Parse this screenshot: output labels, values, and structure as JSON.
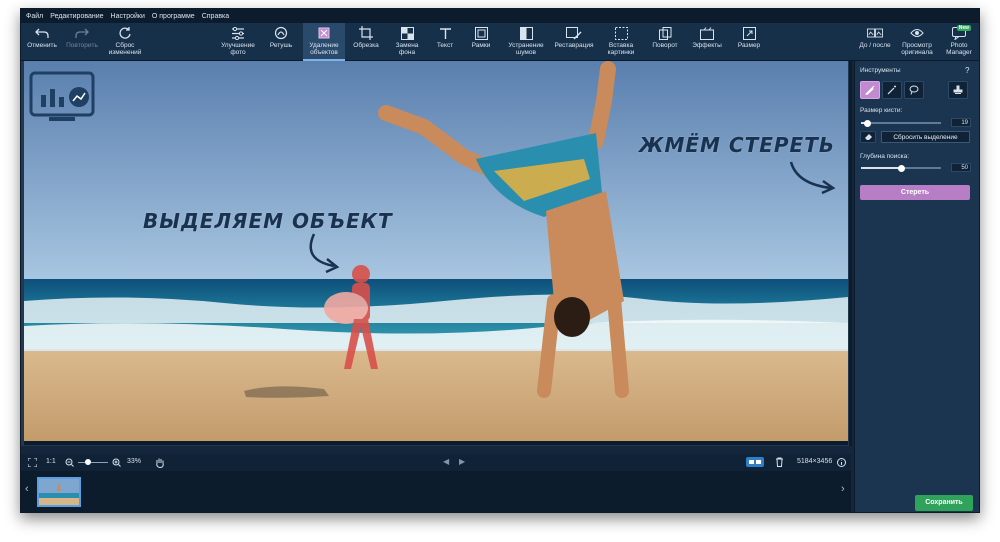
{
  "menu": [
    "Файл",
    "Редактирование",
    "Настройки",
    "О программе",
    "Справка"
  ],
  "toolbar": {
    "undo": "Отменить",
    "redo": "Повторить",
    "reset": "Сброс\nизменений",
    "enhance": "Улучшение\nфото",
    "retouch": "Ретушь",
    "remove": "Удаление\nобъектов",
    "crop": "Обрезка",
    "background": "Замена\nфона",
    "text": "Текст",
    "frames": "Рамки",
    "denoise": "Устранение\nшумов",
    "restore": "Реставрация",
    "insert": "Вставка\nкартинки",
    "rotate": "Поворот",
    "effects": "Эффекты",
    "resize": "Размер",
    "before_after": "До / после",
    "preview": "Просмотр\nоригинала",
    "photo_manager": "Photo\nManager",
    "new_badge": "New"
  },
  "annotations": {
    "select_object": "ВЫДЕЛЯЕМ ОБЪЕКТ",
    "press_erase": "ЖМЁМ СТЕРЕТЬ"
  },
  "panel": {
    "tools_title": "Инструменты",
    "help": "?",
    "brush_size_label": "Размер кисти:",
    "brush_size_value": "19",
    "brush_size_fraction": 0.08,
    "reset_selection": "Сбросить выделение",
    "search_depth_label": "Глубина поиска:",
    "search_depth_value": "50",
    "search_depth_fraction": 0.5,
    "erase": "Стереть",
    "save": "Сохранить"
  },
  "status": {
    "fit": "1:1",
    "zoom": "33%",
    "zoom_fraction": 0.33,
    "dimensions": "5184×3456"
  },
  "colors": {
    "accent": "#b77ec6",
    "save": "#2fa35a",
    "selection": "#d8504a"
  }
}
